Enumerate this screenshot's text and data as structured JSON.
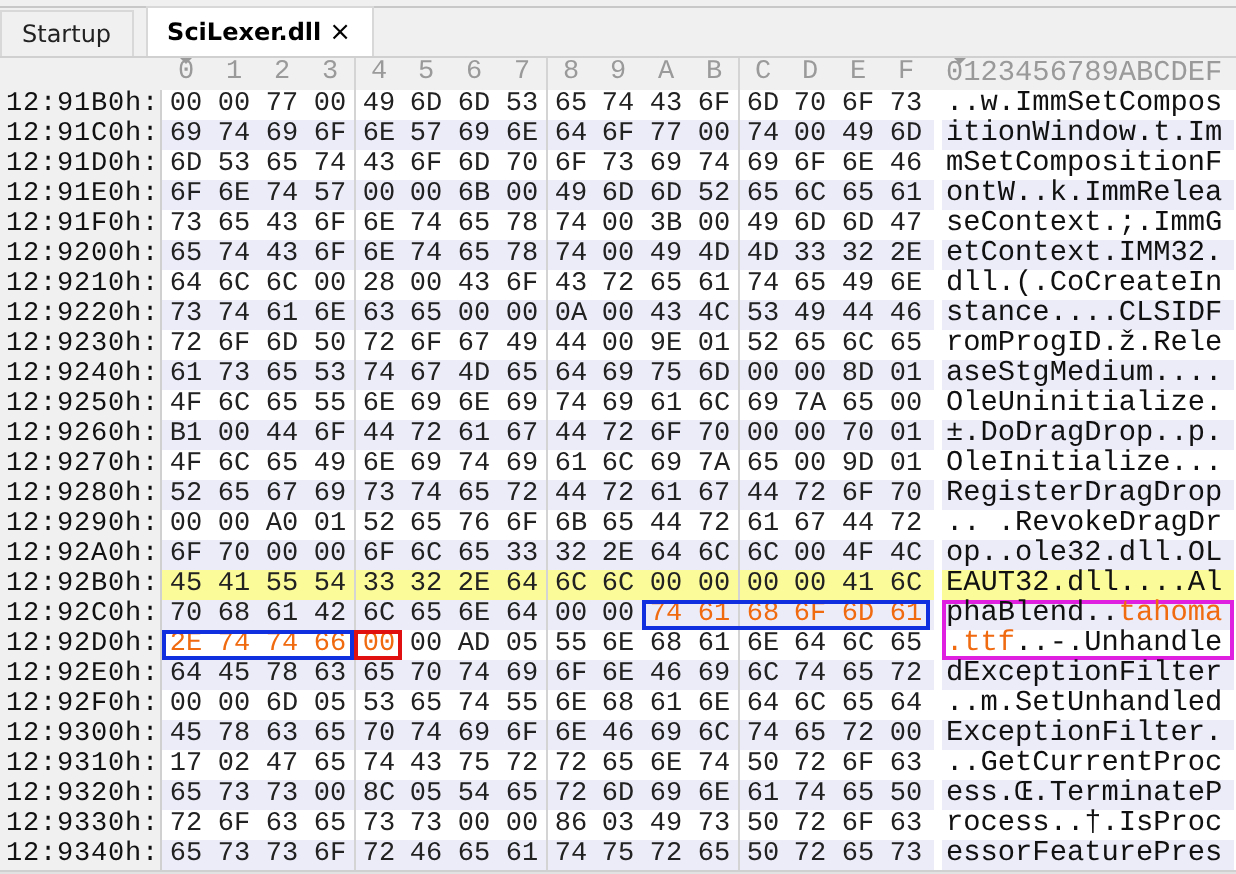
{
  "tabs": [
    {
      "label": "Startup",
      "selected": false
    },
    {
      "label": "SciLexer.dll",
      "selected": true,
      "close": "×"
    }
  ],
  "columns": [
    {
      "label": "0",
      "selected": true
    },
    {
      "label": "1",
      "selected": false
    },
    {
      "label": "2",
      "selected": false
    },
    {
      "label": "3",
      "selected": false
    },
    {
      "label": "4",
      "selected": false
    },
    {
      "label": "5",
      "selected": false
    },
    {
      "label": "6",
      "selected": false
    },
    {
      "label": "7",
      "selected": false
    },
    {
      "label": "8",
      "selected": false
    },
    {
      "label": "9",
      "selected": false
    },
    {
      "label": "A",
      "selected": false
    },
    {
      "label": "B",
      "selected": false
    },
    {
      "label": "C",
      "selected": false
    },
    {
      "label": "D",
      "selected": false
    },
    {
      "label": "E",
      "selected": false
    },
    {
      "label": "F",
      "selected": false
    }
  ],
  "ascii_header": "0123456789ABCDEF",
  "rows": [
    {
      "offset": "12:91B0h:",
      "highlighted": false,
      "hex": [
        {
          "bytes": "00 00 77 00 49 6D 6D 53 65 74 43 6F 6D 70 6F 73"
        }
      ],
      "ascii": [
        {
          "text": "..w.ImmSetCompos"
        }
      ]
    },
    {
      "offset": "12:91C0h:",
      "highlighted": false,
      "hex": [
        {
          "bytes": "69 74 69 6F 6E 57 69 6E 64 6F 77 00 74 00 49 6D"
        }
      ],
      "ascii": [
        {
          "text": "itionWindow.t.Im"
        }
      ]
    },
    {
      "offset": "12:91D0h:",
      "highlighted": false,
      "hex": [
        {
          "bytes": "6D 53 65 74 43 6F 6D 70 6F 73 69 74 69 6F 6E 46"
        }
      ],
      "ascii": [
        {
          "text": "mSetCompositionF"
        }
      ]
    },
    {
      "offset": "12:91E0h:",
      "highlighted": false,
      "hex": [
        {
          "bytes": "6F 6E 74 57 00 00 6B 00 49 6D 6D 52 65 6C 65 61"
        }
      ],
      "ascii": [
        {
          "text": "ontW..k.ImmRelea"
        }
      ]
    },
    {
      "offset": "12:91F0h:",
      "highlighted": false,
      "hex": [
        {
          "bytes": "73 65 43 6F 6E 74 65 78 74 00 3B 00 49 6D 6D 47"
        }
      ],
      "ascii": [
        {
          "text": "seContext.;.ImmG"
        }
      ]
    },
    {
      "offset": "12:9200h:",
      "highlighted": false,
      "hex": [
        {
          "bytes": "65 74 43 6F 6E 74 65 78 74 00 49 4D 4D 33 32 2E"
        }
      ],
      "ascii": [
        {
          "text": "etContext.IMM32."
        }
      ]
    },
    {
      "offset": "12:9210h:",
      "highlighted": false,
      "hex": [
        {
          "bytes": "64 6C 6C 00 28 00 43 6F 43 72 65 61 74 65 49 6E"
        }
      ],
      "ascii": [
        {
          "text": "dll.(.CoCreateIn"
        }
      ]
    },
    {
      "offset": "12:9220h:",
      "highlighted": false,
      "hex": [
        {
          "bytes": "73 74 61 6E 63 65 00 00 0A 00 43 4C 53 49 44 46"
        }
      ],
      "ascii": [
        {
          "text": "stance....CLSIDF"
        }
      ]
    },
    {
      "offset": "12:9230h:",
      "highlighted": false,
      "hex": [
        {
          "bytes": "72 6F 6D 50 72 6F 67 49 44 00 9E 01 52 65 6C 65"
        }
      ],
      "ascii": [
        {
          "text": "romProgID.ž.Rele"
        }
      ]
    },
    {
      "offset": "12:9240h:",
      "highlighted": false,
      "hex": [
        {
          "bytes": "61 73 65 53 74 67 4D 65 64 69 75 6D 00 00 8D 01"
        }
      ],
      "ascii": [
        {
          "text": "aseStgMedium...."
        }
      ]
    },
    {
      "offset": "12:9250h:",
      "highlighted": false,
      "hex": [
        {
          "bytes": "4F 6C 65 55 6E 69 6E 69 74 69 61 6C 69 7A 65 00"
        }
      ],
      "ascii": [
        {
          "text": "OleUninitialize."
        }
      ]
    },
    {
      "offset": "12:9260h:",
      "highlighted": false,
      "hex": [
        {
          "bytes": "B1 00 44 6F 44 72 61 67 44 72 6F 70 00 00 70 01"
        }
      ],
      "ascii": [
        {
          "text": "±.DoDragDrop..p."
        }
      ]
    },
    {
      "offset": "12:9270h:",
      "highlighted": false,
      "hex": [
        {
          "bytes": "4F 6C 65 49 6E 69 74 69 61 6C 69 7A 65 00 9D 01"
        }
      ],
      "ascii": [
        {
          "text": "OleInitialize..."
        }
      ]
    },
    {
      "offset": "12:9280h:",
      "highlighted": false,
      "hex": [
        {
          "bytes": "52 65 67 69 73 74 65 72 44 72 61 67 44 72 6F 70"
        }
      ],
      "ascii": [
        {
          "text": "RegisterDragDrop"
        }
      ]
    },
    {
      "offset": "12:9290h:",
      "highlighted": false,
      "hex": [
        {
          "bytes": "00 00 A0 01 52 65 76 6F 6B 65 44 72 61 67 44 72"
        }
      ],
      "ascii": [
        {
          "text": ".. .RevokeDragDr"
        }
      ]
    },
    {
      "offset": "12:92A0h:",
      "highlighted": false,
      "hex": [
        {
          "bytes": "6F 70 00 00 6F 6C 65 33 32 2E 64 6C 6C 00 4F 4C"
        }
      ],
      "ascii": [
        {
          "text": "op..ole32.dll.OL"
        }
      ]
    },
    {
      "offset": "12:92B0h:",
      "highlighted": true,
      "hex": [
        {
          "bytes": "45 41 55 54 33 32 2E 64 6C 6C 00 00 00 00 41 6C"
        }
      ],
      "ascii": [
        {
          "text": "EAUT32.dll....Al"
        }
      ]
    },
    {
      "offset": "12:92C0h:",
      "highlighted": false,
      "ascii_frame": {
        "color": "#e020e0"
      },
      "hex": [
        {
          "bytes": "70 68 61 42 6C 65 6E 64 00 00"
        },
        {
          "bytes": "74 61 68 6F 6D 61",
          "accent": true,
          "color": "#1030e0"
        }
      ],
      "ascii": [
        {
          "text": "phaBlend.."
        },
        {
          "text": "tahoma",
          "accent": true
        }
      ]
    },
    {
      "offset": "12:92D0h:",
      "highlighted": false,
      "ascii_frame": {
        "color": "#e020e0"
      },
      "hex": [
        {
          "bytes": "2E 74 74 66",
          "accent": true,
          "color": "#1030e0"
        },
        {
          "bytes": "00",
          "accent": true,
          "color": "#e01010"
        },
        {
          "bytes": "00 AD 05 55 6E 68 61 6E 64 6C 65"
        }
      ],
      "ascii": [
        {
          "text": ".ttf",
          "accent": true
        },
        {
          "text": "..-.Unhandle"
        }
      ]
    },
    {
      "offset": "12:92E0h:",
      "highlighted": false,
      "hex": [
        {
          "bytes": "64 45 78 63 65 70 74 69 6F 6E 46 69 6C 74 65 72"
        }
      ],
      "ascii": [
        {
          "text": "dExceptionFilter"
        }
      ]
    },
    {
      "offset": "12:92F0h:",
      "highlighted": false,
      "hex": [
        {
          "bytes": "00 00 6D 05 53 65 74 55 6E 68 61 6E 64 6C 65 64"
        }
      ],
      "ascii": [
        {
          "text": "..m.SetUnhandled"
        }
      ]
    },
    {
      "offset": "12:9300h:",
      "highlighted": false,
      "hex": [
        {
          "bytes": "45 78 63 65 70 74 69 6F 6E 46 69 6C 74 65 72 00"
        }
      ],
      "ascii": [
        {
          "text": "ExceptionFilter."
        }
      ]
    },
    {
      "offset": "12:9310h:",
      "highlighted": false,
      "hex": [
        {
          "bytes": "17 02 47 65 74 43 75 72 72 65 6E 74 50 72 6F 63"
        }
      ],
      "ascii": [
        {
          "text": "..GetCurrentProc"
        }
      ]
    },
    {
      "offset": "12:9320h:",
      "highlighted": false,
      "hex": [
        {
          "bytes": "65 73 73 00 8C 05 54 65 72 6D 69 6E 61 74 65 50"
        }
      ],
      "ascii": [
        {
          "text": "ess.Œ.TerminateP"
        }
      ]
    },
    {
      "offset": "12:9330h:",
      "highlighted": false,
      "hex": [
        {
          "bytes": "72 6F 63 65 73 73 00 00 86 03 49 73 50 72 6F 63"
        }
      ],
      "ascii": [
        {
          "text": "rocess..†.IsProc"
        }
      ]
    },
    {
      "offset": "12:9340h:",
      "highlighted": false,
      "hex": [
        {
          "bytes": "65 73 73 6F 72 46 65 61 74 75 72 65 50 72 65 73"
        }
      ],
      "ascii": [
        {
          "text": "essorFeaturePres"
        }
      ]
    }
  ]
}
